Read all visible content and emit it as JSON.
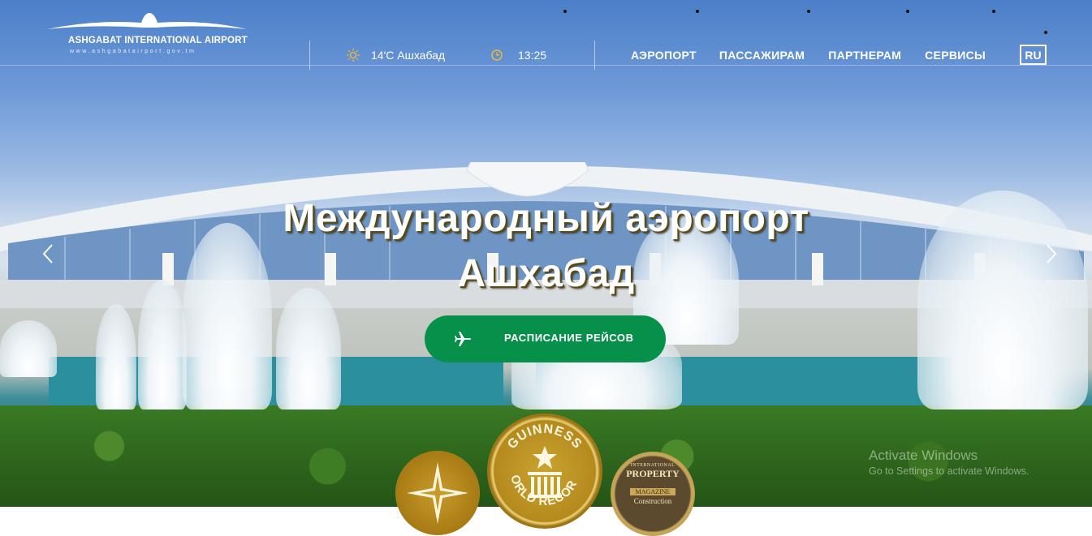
{
  "header": {
    "logo": {
      "name": "ASHGABAT INTERNATIONAL AIRPORT",
      "url": "www.ashgabatairport.gov.tm"
    },
    "weather": {
      "icon": "sun-icon",
      "text": "14'C Ашхабад"
    },
    "clock": {
      "icon": "clock-icon",
      "text": "13:25"
    },
    "nav": [
      {
        "label": "АЭРОПОРТ"
      },
      {
        "label": "ПАССАЖИРАМ"
      },
      {
        "label": "ПАРТНЕРАМ"
      },
      {
        "label": "СЕРВИСЫ"
      }
    ],
    "language": "RU"
  },
  "hero": {
    "title_line1": "Международный аэропорт",
    "title_line2": "Ашхабад",
    "cta_label": "РАСПИСАНИЕ РЕЙСОВ",
    "cta_icon": "airplane-icon",
    "prev_icon": "chevron-left-icon",
    "next_icon": "chevron-right-icon"
  },
  "badges": [
    {
      "name": "star-award-badge"
    },
    {
      "name": "guinness-badge",
      "text_top": "GUINNESS",
      "text_bottom": "WORLD RECORDS"
    },
    {
      "name": "property-award-badge",
      "line1": "INTERNATIONAL",
      "line2": "PROPERTY",
      "line3": "MAGAZINE",
      "line4": "Construction"
    }
  ],
  "watermark": {
    "line1": "Activate Windows",
    "line2": "Go to Settings to activate Windows."
  },
  "colors": {
    "cta": "#07904a",
    "badge_gold": "#c9a227"
  }
}
